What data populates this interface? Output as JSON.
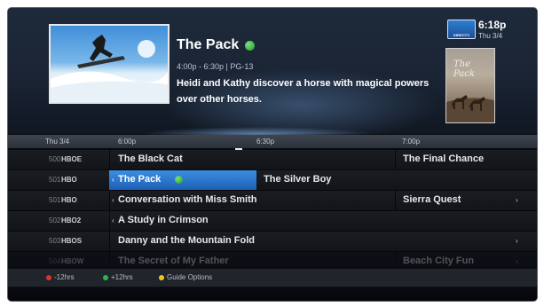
{
  "hero": {
    "title": "The Pack",
    "time_rating": "4:00p - 6:30p | PG-13",
    "description": "Heidi and Kathy discover a horse with magical powers over other horses.",
    "thumbnail_icon": "snowboarder-image",
    "poster_title": "The Pack"
  },
  "header": {
    "clock": "6:18p",
    "date": "Thu 3/4",
    "provider_logo_text": "DIRECTV"
  },
  "timebar": {
    "day": "Thu 3/4",
    "slots": [
      "6:00p",
      "6:30p",
      "7:00p"
    ]
  },
  "channels": [
    {
      "number": "500",
      "name": "HBOE",
      "programs": [
        {
          "title": "The Black Cat"
        },
        {
          "title": "The Final Chance"
        }
      ]
    },
    {
      "number": "501",
      "name": "HBO",
      "programs": [
        {
          "title": "The Pack"
        },
        {
          "title": "The Silver Boy"
        }
      ]
    },
    {
      "number": "501",
      "name": "HBO",
      "programs": [
        {
          "title": "Conversation with Miss Smith"
        },
        {
          "title": "Sierra Quest"
        }
      ]
    },
    {
      "number": "502",
      "name": "HBO2",
      "programs": [
        {
          "title": "A Study in Crimson"
        }
      ]
    },
    {
      "number": "503",
      "name": "HBOS",
      "programs": [
        {
          "title": "Danny and the Mountain Fold"
        }
      ]
    },
    {
      "number": "504",
      "name": "HBOW",
      "programs": [
        {
          "title": "The Secret of My Father"
        },
        {
          "title": "Beach City Fun"
        }
      ]
    }
  ],
  "footer": {
    "red": {
      "label": "-12hrs",
      "color": "#e0302e"
    },
    "green": {
      "label": "+12hrs",
      "color": "#2fb34a"
    },
    "yellow": {
      "label": "Guide Options",
      "color": "#e8c81c"
    }
  }
}
